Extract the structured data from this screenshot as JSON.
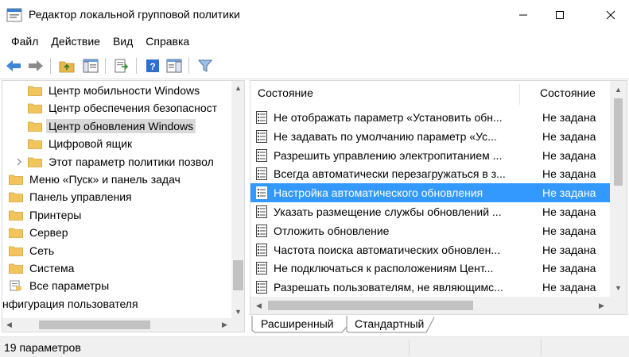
{
  "window": {
    "title": "Редактор локальной групповой политики",
    "min_glyph": "—",
    "max_glyph": "☐",
    "close_glyph": "✕"
  },
  "menu": [
    "Файл",
    "Действие",
    "Вид",
    "Справка"
  ],
  "toolbar": {
    "icons": [
      "back-arrow-icon",
      "forward-arrow-icon",
      "up-folder-icon",
      "show-hide-tree-icon",
      "export-list-icon",
      "help-icon",
      "properties-pane-icon",
      "filter-icon"
    ]
  },
  "tree": {
    "items": [
      {
        "label": "Центр мобильности Windows",
        "selected": false,
        "expandable": false
      },
      {
        "label": "Центр обеспечения безопасност",
        "selected": false,
        "expandable": false
      },
      {
        "label": "Центр обновления Windows",
        "selected": true,
        "expandable": false
      },
      {
        "label": "Цифровой ящик",
        "selected": false,
        "expandable": false
      },
      {
        "label": "Этот параметр политики позвол",
        "selected": false,
        "expandable": true
      },
      {
        "label": "Меню «Пуск» и панель задач",
        "selected": false,
        "expandable": false
      },
      {
        "label": "Панель управления",
        "selected": false,
        "expandable": false
      },
      {
        "label": "Принтеры",
        "selected": false,
        "expandable": false
      },
      {
        "label": "Сервер",
        "selected": false,
        "expandable": false
      },
      {
        "label": "Сеть",
        "selected": false,
        "expandable": false
      },
      {
        "label": "Система",
        "selected": false,
        "expandable": false
      },
      {
        "label": "Все параметры",
        "selected": false,
        "expandable": false
      },
      {
        "label": "нфигурация пользователя",
        "selected": false,
        "expandable": false
      }
    ]
  },
  "list": {
    "columns": [
      "Состояние",
      "Состояние"
    ],
    "rows": [
      {
        "name": "Не отображать параметр «Установить обн...",
        "state": "Не задана",
        "selected": false
      },
      {
        "name": "Не задавать по умолчанию параметр «Ус...",
        "state": "Не задана",
        "selected": false
      },
      {
        "name": "Разрешить управлению электропитанием ...",
        "state": "Не задана",
        "selected": false
      },
      {
        "name": "Всегда автоматически перезагружаться в з...",
        "state": "Не задана",
        "selected": false
      },
      {
        "name": "Настройка автоматического обновления",
        "state": "Не задана",
        "selected": true
      },
      {
        "name": "Указать размещение службы обновлений ...",
        "state": "Не задана",
        "selected": false
      },
      {
        "name": "Отложить обновление",
        "state": "Не задана",
        "selected": false
      },
      {
        "name": "Частота поиска автоматических обновлен...",
        "state": "Не задана",
        "selected": false
      },
      {
        "name": "Не подключаться к расположениям Цент...",
        "state": "Не задана",
        "selected": false
      },
      {
        "name": "Разрешать пользователям, не являющимс...",
        "state": "Не задана",
        "selected": false
      }
    ]
  },
  "tabs": [
    "Расширенный",
    "Стандартный"
  ],
  "status": {
    "text": "19 параметров"
  },
  "colors": {
    "selection": "#3399ff",
    "tree_selection": "#d9d9d9",
    "folder": "#f2c55c"
  }
}
